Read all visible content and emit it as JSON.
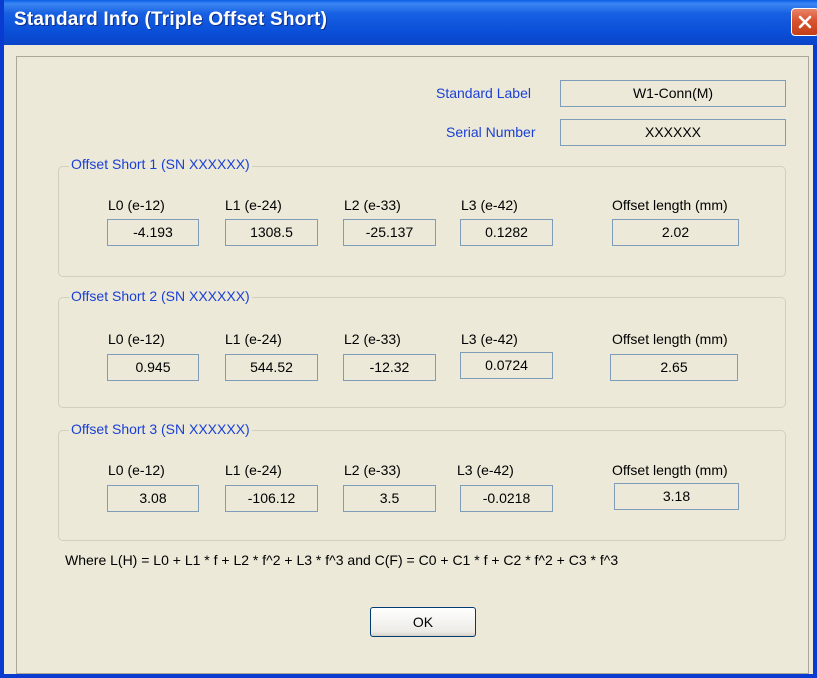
{
  "window": {
    "title": "Standard Info (Triple Offset Short)"
  },
  "header": {
    "standard_label": {
      "label": "Standard Label",
      "value": "W1-Conn(M)"
    },
    "serial_number": {
      "label": "Serial Number",
      "value": "XXXXXX"
    }
  },
  "groups": [
    {
      "title": "Offset Short 1 (SN XXXXXX)",
      "labels": [
        "L0 (e-12)",
        "L1 (e-24)",
        "L2 (e-33)",
        "L3 (e-42)",
        "Offset length (mm)"
      ],
      "values": [
        "-4.193",
        "1308.5",
        "-25.137",
        "0.1282",
        "2.02"
      ]
    },
    {
      "title": "Offset Short 2 (SN XXXXXX)",
      "labels": [
        "L0 (e-12)",
        "L1 (e-24)",
        "L2 (e-33)",
        "L3 (e-42)",
        "Offset length (mm)"
      ],
      "values": [
        "0.945",
        "544.52",
        "-12.32",
        "0.0724",
        "2.65"
      ]
    },
    {
      "title": "Offset Short 3 (SN XXXXXX)",
      "labels": [
        "L0 (e-12)",
        "L1 (e-24)",
        "L2 (e-33)",
        "L3 (e-42)",
        "Offset length (mm)"
      ],
      "values": [
        "3.08",
        "-106.12",
        "3.5",
        "-0.0218",
        "3.18"
      ]
    }
  ],
  "formula": "Where L(H) = L0 + L1 * f + L2 * f^2 + L3 * f^3  and  C(F) = C0 + C1 * f + C2 * f^2 + C3 * f^3",
  "buttons": {
    "ok": "OK"
  }
}
